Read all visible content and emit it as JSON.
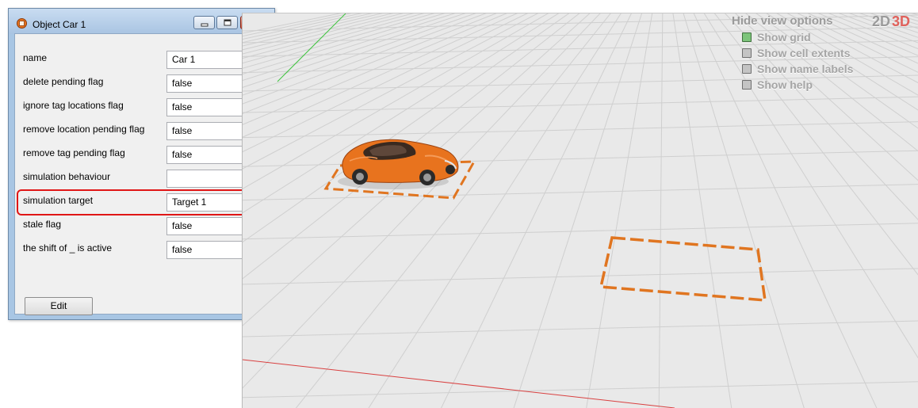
{
  "window": {
    "title": "Object Car 1",
    "edit_label": "Edit"
  },
  "properties": [
    {
      "label": "name",
      "value": "Car 1"
    },
    {
      "label": "delete pending flag",
      "value": "false"
    },
    {
      "label": "ignore tag locations flag",
      "value": "false"
    },
    {
      "label": "remove location pending flag",
      "value": "false"
    },
    {
      "label": "remove tag pending flag",
      "value": "false"
    },
    {
      "label": "simulation behaviour",
      "value": ""
    },
    {
      "label": "simulation target",
      "value": "Target 1"
    },
    {
      "label": "stale flag",
      "value": "false"
    },
    {
      "label": "the shift of _ is active",
      "value": "false"
    }
  ],
  "highlighted_property": "simulation target",
  "view_options": {
    "title": "Hide view options",
    "options": [
      {
        "label": "Show grid",
        "checked": true
      },
      {
        "label": "Show cell extents",
        "checked": false
      },
      {
        "label": "Show name labels",
        "checked": false
      },
      {
        "label": "Show help",
        "checked": false
      }
    ]
  },
  "mode_toggle": {
    "two_d": "2D",
    "three_d": "3D",
    "active": "3D"
  },
  "colors": {
    "car": "#e8731e",
    "cell_outline": "#e07520",
    "axis_x": "#d94040",
    "axis_y": "#3fc43f",
    "highlight": "#e01616"
  },
  "icons": [
    "app-icon",
    "minimize-icon",
    "maximize-icon",
    "close-icon",
    "car-model"
  ]
}
